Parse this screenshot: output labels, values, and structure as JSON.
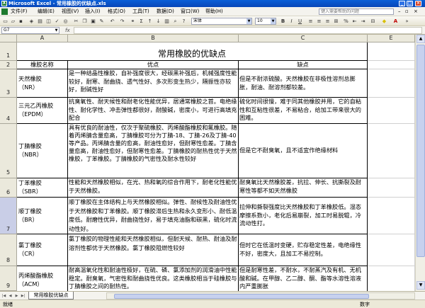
{
  "window": {
    "title": "Microsoft Excel - 常用橡胶的优缺点.xls"
  },
  "menu": {
    "items": [
      "文件(F)",
      "编辑(E)",
      "视图(V)",
      "插入(I)",
      "格式(O)",
      "工具(T)",
      "数据(D)",
      "窗口(W)",
      "帮助(H)"
    ],
    "help_placeholder": "键入需要帮助的问题"
  },
  "toolbar": {
    "font": "宋体",
    "size": "10"
  },
  "formula_bar": {
    "cell_ref": "G7",
    "fx": "fx",
    "value": ""
  },
  "columns": [
    "A",
    "B",
    "C",
    "E"
  ],
  "rows": [
    "1",
    "2",
    "3",
    "4",
    "5",
    "6",
    "7",
    "8",
    "9"
  ],
  "sheet": {
    "title": "常用橡胶的优缺点",
    "headers": {
      "name": "橡胶名称",
      "pros": "优点",
      "cons": "缺点"
    },
    "records": [
      {
        "name": "天然橡胶\n（NR）",
        "pros": "是一种结晶性橡胶，自补强度很大，经碳黑补强后，机械强度性能较好，耐寒、耐曲挠、透气性好、多次形变生热少，隔振性亦较好，耐碱性好",
        "cons": "但是不耐浓硫酸。天然橡胶在非极性溶剂总膨胀，耐油、耐溶剂都较差。"
      },
      {
        "name": "三元乙丙橡胶\n（EPDM）",
        "pros": "抗臭氧性、耐天候性和耐老化性能优异，居通常橡胶之首。电绝缘性、耐化学性、冲击弹性都很好，耐酸碱，密度小，可进行高填充配合",
        "cons": "硫化时间很慢，难于同其他橡胶并用，它的自粘性和互粘性很差，不易粘合，给加工带来很大的困难。"
      },
      {
        "name": "丁腈橡胶\n（NBR）",
        "pros": "具有优良的耐油性，仅次于聚硫橡胶、丙烯酸酯橡胶和氟橡胶。随着丙烯腈含量愈高，丁腈橡胶可分为丁腈-18、丁腈-26及丁腈-40等产品。丙烯腈含量的愈高，耐油性愈好，但耐寒性愈差。丁腈含量愈高，耐油性愈好，但耐寒性愈差。丁腈橡胶的耐热性优于天然橡胶，丁苯橡胶。丁腈橡胶的气密性及耐水性较好",
        "cons": "但是它不耐臭氧，且不适宜作绝缘材料"
      },
      {
        "name": "丁苯橡胶\n（SBR）",
        "pros": "性能和天然橡胶相似，在光、热和氧的综合作用下，耐老化性能优于天然橡胶。",
        "cons": "耐臭氧比天然橡胶差，抗拉、伸长、抗撕裂及耐寒性等都不如天然橡胶"
      },
      {
        "name": "顺丁橡胶\n（BR）",
        "pros": "顺丁橡胶在主体结构上与天然橡胶相似。弹性、耐候性及耐油性优于天然橡胶和丁苯橡胶。顺丁橡胶滞后生热和永久变形小、耐低温度低。耐磨性优异，耐曲挠性好，易于填充油脂和碳黑，硫化时流动性好。",
        "cons": "拉伸和撕裂强度比天然橡胶和丁苯橡胶低。湿态摩擦系数小，老化后易崩裂，加工时易脱辊，冷流动性打。"
      },
      {
        "name": "氯丁橡胶\n（CR）",
        "pros": "氯丁橡胶的物理性能和天然橡胶相似，但耐天候、耐热、耐油及耐溶剂性都优于天然橡胶。氯丁橡胶阻燃性较好",
        "cons": "但时它在低温时变硬，贮存稳定性差，电绝缘性不好，密度大，且加工不易控制。"
      },
      {
        "name": "丙烯酸酯橡胶\n（ACM）",
        "pros": "耐高温氧化性和耐油性极好，在硫、磷、氯添加剂的润滑油中性能稳定。耐臭氧，气密性和耐曲挠性优良。这类橡胶相当于硅橡胶与丁腈橡胶之间的耐热性。",
        "cons": "但是耐寒性差，不耐水，不耐蒸汽及有机、无机酸和碱。在甲醇、乙二醇、酮、酯等水溶性溶液内严重膨胀"
      }
    ]
  },
  "tabs": {
    "active": "常用橡胶优缺点"
  },
  "status": {
    "left": "就绪",
    "right": "数字"
  }
}
